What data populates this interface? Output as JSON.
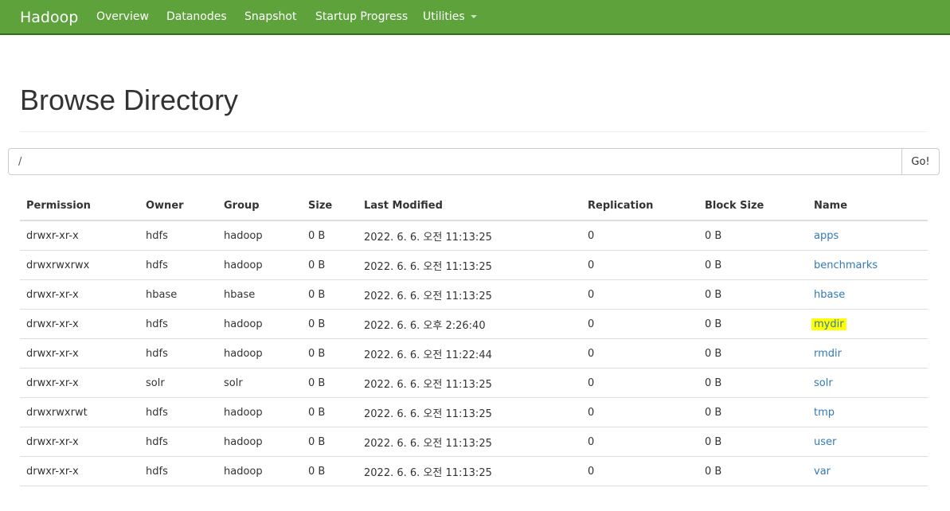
{
  "navbar": {
    "brand": "Hadoop",
    "items": [
      {
        "label": "Overview"
      },
      {
        "label": "Datanodes"
      },
      {
        "label": "Snapshot"
      },
      {
        "label": "Startup Progress"
      },
      {
        "label": "Utilities"
      }
    ],
    "utilities_icon": "caret-down-icon"
  },
  "page": {
    "title": "Browse Directory"
  },
  "path_bar": {
    "value": "/",
    "go_label": "Go!"
  },
  "table": {
    "columns": [
      "Permission",
      "Owner",
      "Group",
      "Size",
      "Last Modified",
      "Replication",
      "Block Size",
      "Name"
    ],
    "rows": [
      {
        "permission": "drwxr-xr-x",
        "owner": "hdfs",
        "group": "hadoop",
        "size": "0 B",
        "modified": "2022. 6. 6. 오전 11:13:25",
        "replication": "0",
        "block_size": "0 B",
        "name": "apps"
      },
      {
        "permission": "drwxrwxrwx",
        "owner": "hdfs",
        "group": "hadoop",
        "size": "0 B",
        "modified": "2022. 6. 6. 오전 11:13:25",
        "replication": "0",
        "block_size": "0 B",
        "name": "benchmarks"
      },
      {
        "permission": "drwxr-xr-x",
        "owner": "hbase",
        "group": "hbase",
        "size": "0 B",
        "modified": "2022. 6. 6. 오전 11:13:25",
        "replication": "0",
        "block_size": "0 B",
        "name": "hbase"
      },
      {
        "permission": "drwxr-xr-x",
        "owner": "hdfs",
        "group": "hadoop",
        "size": "0 B",
        "modified": "2022. 6. 6. 오후 2:26:40",
        "replication": "0",
        "block_size": "0 B",
        "name": "mydir",
        "highlighted": true
      },
      {
        "permission": "drwxr-xr-x",
        "owner": "hdfs",
        "group": "hadoop",
        "size": "0 B",
        "modified": "2022. 6. 6. 오전 11:22:44",
        "replication": "0",
        "block_size": "0 B",
        "name": "rmdir"
      },
      {
        "permission": "drwxr-xr-x",
        "owner": "solr",
        "group": "solr",
        "size": "0 B",
        "modified": "2022. 6. 6. 오전 11:13:25",
        "replication": "0",
        "block_size": "0 B",
        "name": "solr"
      },
      {
        "permission": "drwxrwxrwt",
        "owner": "hdfs",
        "group": "hadoop",
        "size": "0 B",
        "modified": "2022. 6. 6. 오전 11:13:25",
        "replication": "0",
        "block_size": "0 B",
        "name": "tmp"
      },
      {
        "permission": "drwxr-xr-x",
        "owner": "hdfs",
        "group": "hadoop",
        "size": "0 B",
        "modified": "2022. 6. 6. 오전 11:13:25",
        "replication": "0",
        "block_size": "0 B",
        "name": "user"
      },
      {
        "permission": "drwxr-xr-x",
        "owner": "hdfs",
        "group": "hadoop",
        "size": "0 B",
        "modified": "2022. 6. 6. 오전 11:13:25",
        "replication": "0",
        "block_size": "0 B",
        "name": "var"
      }
    ]
  },
  "colors": {
    "navbar_bg": "#5ea23c",
    "link": "#337ab7",
    "highlight": "#ffff00"
  }
}
